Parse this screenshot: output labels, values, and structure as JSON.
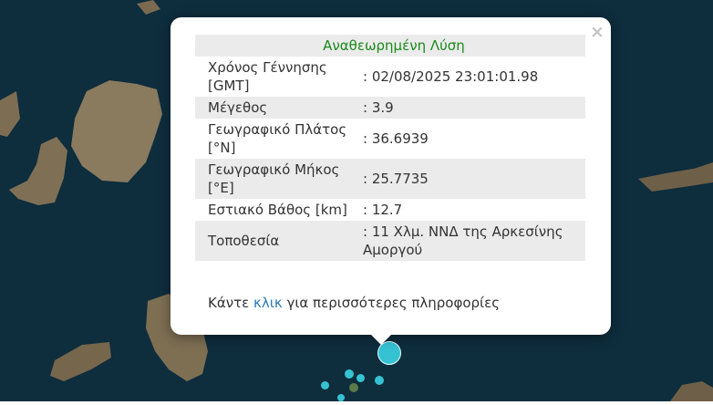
{
  "popup": {
    "header": "Αναθεωρημένη Λύση",
    "rows": [
      {
        "label": "Χρόνος Γέννησης [GMT]",
        "value": ": 02/08/2025 23:01:01.98"
      },
      {
        "label": "Μέγεθος",
        "value": ": 3.9"
      },
      {
        "label": "Γεωγραφικό Πλάτος [°N]",
        "value": ": 36.6939"
      },
      {
        "label": "Γεωγραφικό Μήκος [°E]",
        "value": ": 25.7735"
      },
      {
        "label": "Εστιακό Βάθος [km]",
        "value": ": 12.7"
      },
      {
        "label": "Τοποθεσία",
        "value": ": 11 Χλμ. ΝΝΔ της Αρκεσίνης Αμοργού"
      }
    ],
    "footer_prefix": "Κάντε",
    "footer_link": "κλικ",
    "footer_suffix": "για περισσότερες πληροφορίες",
    "close_label": "×"
  },
  "map": {
    "water_color": "#0d2a3a",
    "land_color": "#7a6a50",
    "marker_color": "#35c3d3"
  }
}
